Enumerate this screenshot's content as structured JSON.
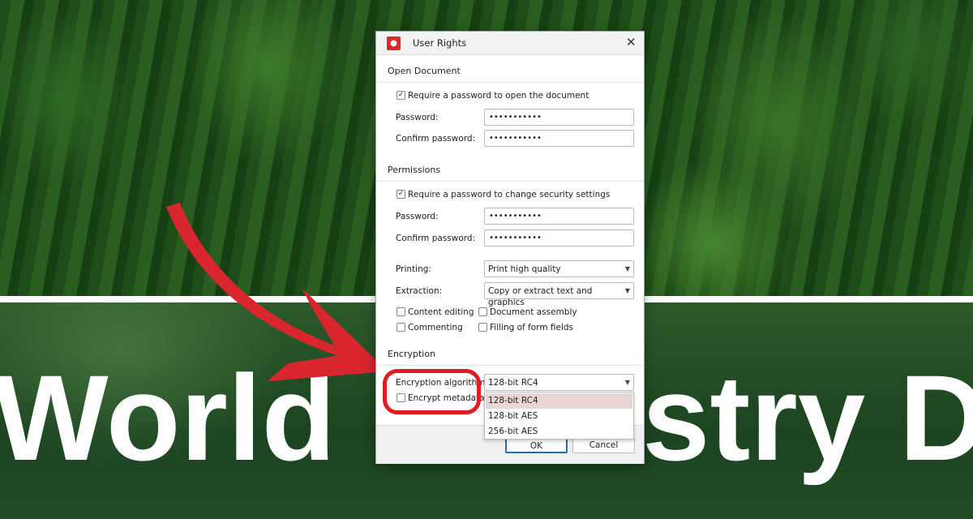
{
  "background": {
    "headline_left": "World",
    "headline_right": "stry D"
  },
  "dialog": {
    "title": "User Rights",
    "open_document": {
      "section": "Open Document",
      "require_label": "Require a password to open the document",
      "require_checked": true,
      "password_label": "Password:",
      "password_value": "•••••••••••",
      "confirm_label": "Confirm password:",
      "confirm_value": "•••••••••••"
    },
    "permissions": {
      "section": "Permissions",
      "require_label": "Require a password to change security settings",
      "require_checked": true,
      "password_label": "Password:",
      "password_value": "•••••••••••",
      "confirm_label": "Confirm password:",
      "confirm_value": "•••••••••••",
      "printing_label": "Printing:",
      "printing_value": "Print high quality",
      "extraction_label": "Extraction:",
      "extraction_value": "Copy or extract text and graphics",
      "checkboxes": [
        {
          "label": "Content editing",
          "checked": false
        },
        {
          "label": "Document assembly",
          "checked": false
        },
        {
          "label": "Commenting",
          "checked": false
        },
        {
          "label": "Filling of form fields",
          "checked": false
        }
      ]
    },
    "encryption": {
      "section": "Encryption",
      "algorithm_label": "Encryption algorithm:",
      "algorithm_value": "128-bit RC4",
      "metadata_label": "Encrypt metadata",
      "metadata_checked": false,
      "options": [
        "128-bit RC4",
        "128-bit AES",
        "256-bit AES"
      ],
      "selected_option": "128-bit RC4"
    },
    "ok_label": "OK",
    "cancel_label": "Cancel"
  },
  "colors": {
    "annotation_red": "#e01b24",
    "app_icon_red": "#d92b2b",
    "selected_option_bg": "#e8d6d6",
    "ok_border": "#2b6cb0"
  }
}
